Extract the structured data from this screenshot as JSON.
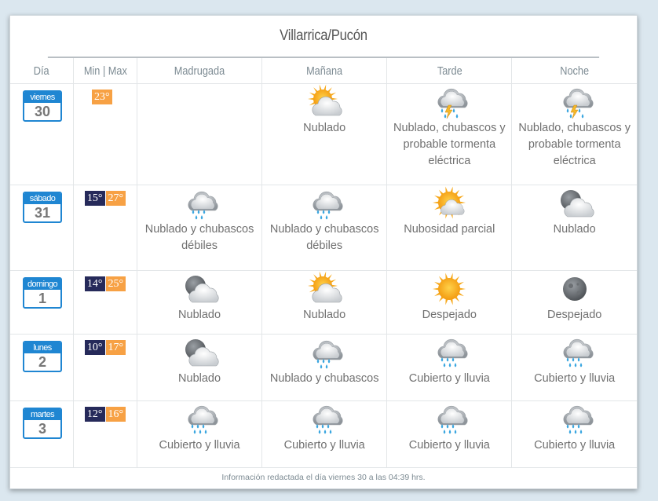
{
  "title": "Villarrica/Pucón",
  "headers": [
    "Día",
    "Min | Max",
    "Madrugada",
    "Mañana",
    "Tarde",
    "Noche"
  ],
  "days": [
    {
      "day_name": "viernes",
      "day_num": "30",
      "min": "",
      "max": "23°",
      "periods": [
        {
          "icon": "",
          "label": ""
        },
        {
          "icon": "sun-cloud-icon",
          "label": "Nublado"
        },
        {
          "icon": "storm-icon",
          "label": "Nublado, chubascos y probable tormenta eléctrica"
        },
        {
          "icon": "storm-icon",
          "label": "Nublado, chubascos y probable tormenta eléctrica"
        }
      ]
    },
    {
      "day_name": "sábado",
      "day_num": "31",
      "min": "15°",
      "max": "27°",
      "periods": [
        {
          "icon": "light-rain-icon",
          "label": "Nublado y chubascos débiles"
        },
        {
          "icon": "light-rain-icon",
          "label": "Nublado y chubascos débiles"
        },
        {
          "icon": "partly-sunny-icon",
          "label": "Nubosidad parcial"
        },
        {
          "icon": "moon-cloud-icon",
          "label": "Nublado"
        }
      ]
    },
    {
      "day_name": "domingo",
      "day_num": "1",
      "min": "14°",
      "max": "25°",
      "periods": [
        {
          "icon": "moon-cloud-icon",
          "label": "Nublado"
        },
        {
          "icon": "sun-cloud-icon",
          "label": "Nublado"
        },
        {
          "icon": "sun-icon",
          "label": "Despejado"
        },
        {
          "icon": "moon-icon",
          "label": "Despejado"
        }
      ]
    },
    {
      "day_name": "lunes",
      "day_num": "2",
      "min": "10°",
      "max": "17°",
      "periods": [
        {
          "icon": "moon-cloud-icon",
          "label": "Nublado"
        },
        {
          "icon": "light-rain-icon",
          "label": "Nublado y chubascos"
        },
        {
          "icon": "heavy-rain-icon",
          "label": "Cubierto y lluvia"
        },
        {
          "icon": "heavy-rain-icon",
          "label": "Cubierto y lluvia"
        }
      ]
    },
    {
      "day_name": "martes",
      "day_num": "3",
      "min": "12°",
      "max": "16°",
      "periods": [
        {
          "icon": "heavy-rain-icon",
          "label": "Cubierto y lluvia"
        },
        {
          "icon": "heavy-rain-icon",
          "label": "Cubierto y lluvia"
        },
        {
          "icon": "heavy-rain-icon",
          "label": "Cubierto y lluvia"
        },
        {
          "icon": "heavy-rain-icon",
          "label": "Cubierto y lluvia"
        }
      ]
    }
  ],
  "footer": "Información redactada el día viernes 30 a las 04:39 hrs.",
  "colors": {
    "date_blue": "#1f86d2",
    "min_navy": "#262a5a",
    "max_orange": "#f7a144"
  }
}
